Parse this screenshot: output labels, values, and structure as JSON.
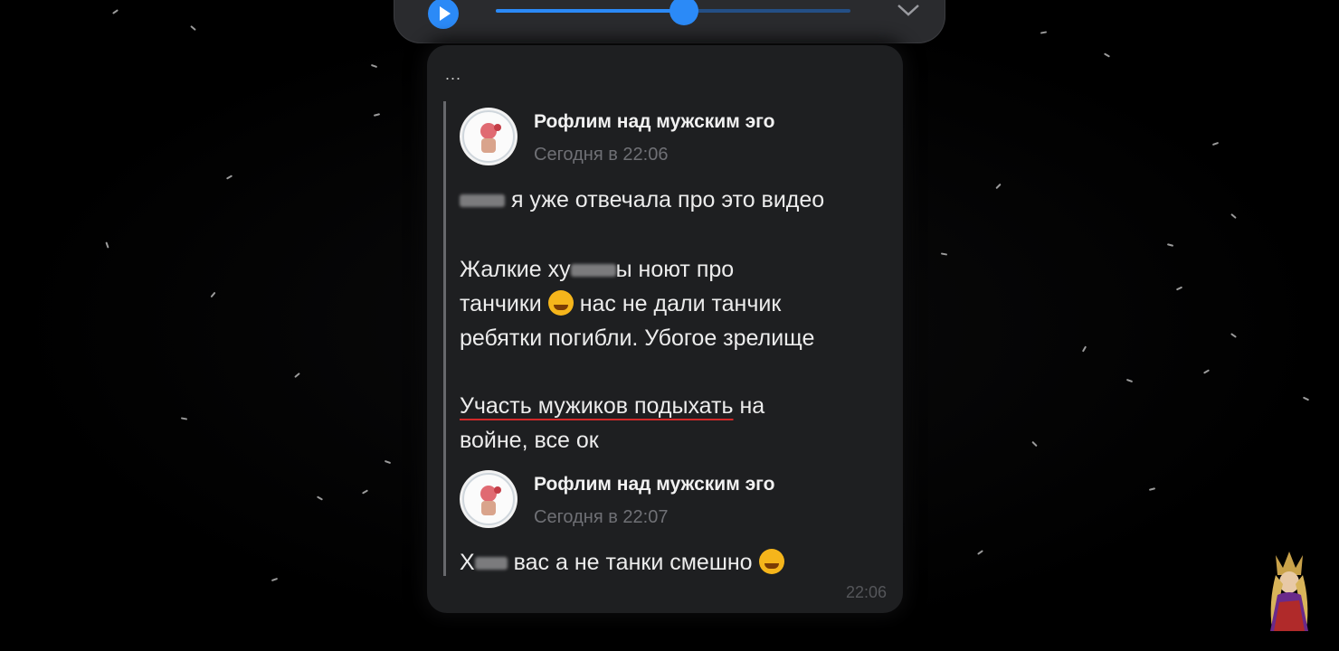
{
  "player": {
    "progress": 0.53,
    "accent": "#2b8af7",
    "play_icon": "play-icon",
    "collapse_icon": "chevron-down-icon"
  },
  "card": {
    "menu_dots": "...",
    "posts": [
      {
        "author": "Рофлим над мужским эго",
        "time": "Сегодня в 22:06"
      },
      {
        "author": "Рофлим над мужским эго",
        "time": "Сегодня в 22:07"
      }
    ],
    "msg1_line1": "я уже отвечала про это видео",
    "msg1_p2_a": "Жалкие ху",
    "msg1_p2_b": "ы ноют про",
    "msg1_p2_c": "танчики",
    "msg1_p2_d": "нас не дали танчик",
    "msg1_p2_e": "ребятки погибли. Убогое зрелище",
    "msg1_p3_underlined": "Участь мужиков подыхать",
    "msg1_p3_rest": " на",
    "msg1_p3_line2": "войне, все ок",
    "msg2_a": "Х",
    "msg2_b": "вас а не танки смешно",
    "timestamp": "22:06"
  }
}
